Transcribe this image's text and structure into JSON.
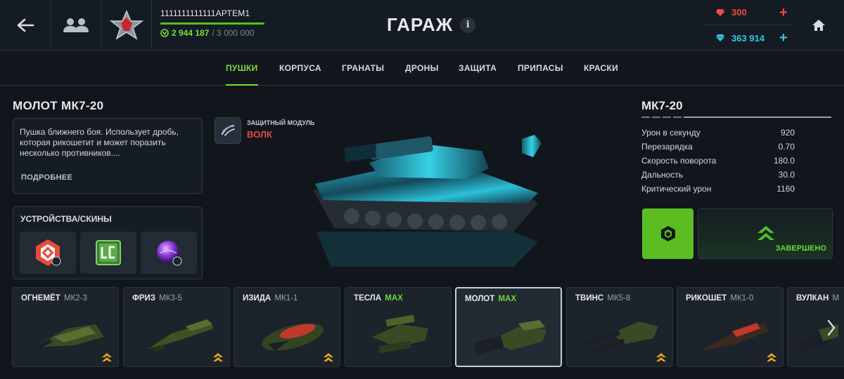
{
  "header": {
    "player_name": "1111111111111АРТЕМ1",
    "xp_current": "2 944 187",
    "xp_max": "/ 3 000 000",
    "xp_progress": 0.98,
    "title": "ГАРАЖ",
    "info_label": "i"
  },
  "currency": {
    "rubies": "300",
    "crystals": "363 914",
    "ruby_color": "#f04a4a",
    "crystal_color": "#31c6e3"
  },
  "tabs": [
    {
      "label": "ПУШКИ",
      "active": true
    },
    {
      "label": "КОРПУСА",
      "active": false
    },
    {
      "label": "ГРАНАТЫ",
      "active": false
    },
    {
      "label": "ДРОНЫ",
      "active": false
    },
    {
      "label": "ЗАЩИТА",
      "active": false
    },
    {
      "label": "ПРИПАСЫ",
      "active": false
    },
    {
      "label": "КРАСКИ",
      "active": false
    }
  ],
  "weapon": {
    "title": "МОЛОТ МК7-20",
    "description": "Пушка ближнего боя. Использует дробь, которая рикошетит и может поразить несколько противников....",
    "more_label": "ПОДРОБНЕЕ"
  },
  "skins": {
    "title": "УСТРОЙСТВА/СКИНЫ",
    "items": [
      "device-icon",
      "lc-skin-icon",
      "purple-orb-icon"
    ]
  },
  "module": {
    "label": "ЗАЩИТНЫЙ МОДУЛЬ",
    "name": "ВОЛК"
  },
  "stats": {
    "title": "МК7-20",
    "rows": [
      {
        "label": "Урон в секунду",
        "value": "920"
      },
      {
        "label": "Перезарядка",
        "value": "0.70"
      },
      {
        "label": "Скорость поворота",
        "value": "180.0"
      },
      {
        "label": "Дальность",
        "value": "30.0"
      },
      {
        "label": "Критический урон",
        "value": "1160"
      }
    ],
    "upgrade_status": "ЗАВЕРШЕНО",
    "accent": "#5bbd22"
  },
  "weapons_list": [
    {
      "name": "ОГНЕМЁТ",
      "level": "МК2-3",
      "max": false
    },
    {
      "name": "ФРИЗ",
      "level": "МК3-5",
      "max": false
    },
    {
      "name": "ИЗИДА",
      "level": "МК1-1",
      "max": false
    },
    {
      "name": "ТЕСЛА",
      "level": "MAX",
      "max": true
    },
    {
      "name": "МОЛОТ",
      "level": "MAX",
      "max": true,
      "selected": true
    },
    {
      "name": "ТВИНС",
      "level": "МК5-8",
      "max": false
    },
    {
      "name": "РИКОШЕТ",
      "level": "МК1-0",
      "max": false
    },
    {
      "name": "ВУЛКАН",
      "level": "М",
      "max": false
    }
  ]
}
